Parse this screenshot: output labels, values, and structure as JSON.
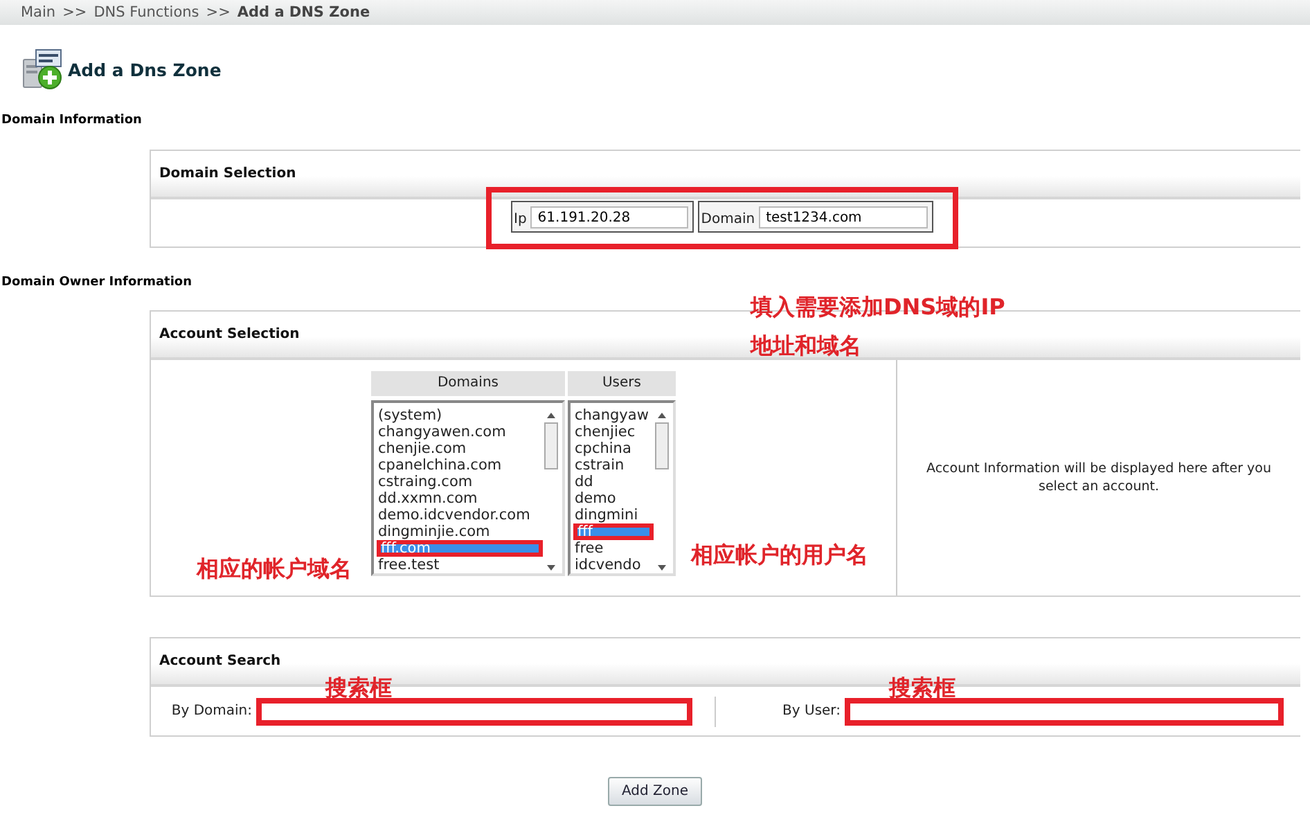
{
  "breadcrumb": {
    "items": [
      "Main",
      "DNS Functions",
      "Add a DNS Zone"
    ],
    "separator": ">>"
  },
  "page_title": "Add a Dns Zone",
  "domain_information": {
    "heading": "Domain Information",
    "panel": {
      "title": "Domain Selection",
      "highlighted": true,
      "fields": [
        {
          "label": "Ip",
          "value": "61.191.20.28"
        },
        {
          "label": "Domain",
          "value": "test1234.com"
        }
      ]
    }
  },
  "domain_owner_information": {
    "heading": "Domain Owner Information",
    "panel": {
      "title": "Account Selection",
      "lists": [
        {
          "header": "Domains",
          "items": [
            {
              "text": "(system)",
              "selected": false
            },
            {
              "text": "changyawen.com",
              "selected": false
            },
            {
              "text": "chenjie.com",
              "selected": false
            },
            {
              "text": "cpanelchina.com",
              "selected": false
            },
            {
              "text": "cstraing.com",
              "selected": false
            },
            {
              "text": "dd.xxmn.com",
              "selected": false
            },
            {
              "text": "demo.idcvendor.com",
              "selected": false
            },
            {
              "text": "dingminjie.com",
              "selected": false
            },
            {
              "text": "fff.com",
              "selected": true
            },
            {
              "text": "free.test",
              "selected": false
            }
          ]
        },
        {
          "header": "Users",
          "items": [
            {
              "text": "changyaw",
              "selected": false
            },
            {
              "text": "chenjiec",
              "selected": false
            },
            {
              "text": "cpchina",
              "selected": false
            },
            {
              "text": "cstrain",
              "selected": false
            },
            {
              "text": "dd",
              "selected": false
            },
            {
              "text": "demo",
              "selected": false
            },
            {
              "text": "dingmini",
              "selected": false
            },
            {
              "text": "fff",
              "selected": true
            },
            {
              "text": "free",
              "selected": false
            },
            {
              "text": "idcvendo",
              "selected": false
            }
          ]
        }
      ],
      "info": "Account Information will be displayed here after you select an account."
    }
  },
  "account_search": {
    "title": "Account Search",
    "fields": [
      {
        "label": "By Domain:",
        "highlighted": true
      },
      {
        "label": "By User:",
        "highlighted": true
      }
    ]
  },
  "button": "Add Zone",
  "annotations": [
    "填入需要添加DNS域的IP",
    "地址和域名",
    "相应的帐户域名",
    "相应帐户的用户名",
    "搜索框",
    "搜索框"
  ]
}
